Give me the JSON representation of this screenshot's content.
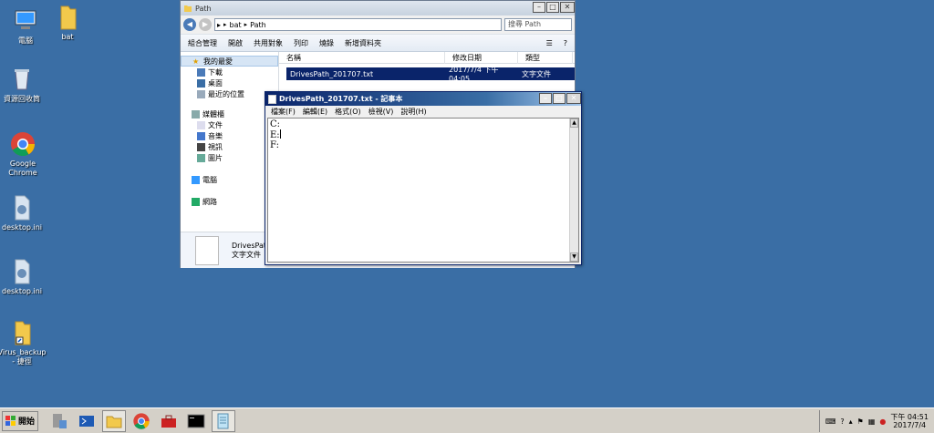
{
  "desktop": {
    "icons": [
      {
        "label": "電腦",
        "icon": "computer-icon"
      },
      {
        "label": "bat",
        "icon": "folder-icon"
      },
      {
        "label": "資源回收筒",
        "icon": "recycle-bin-icon"
      },
      {
        "label": "Google Chrome",
        "icon": "chrome-icon"
      },
      {
        "label": "desktop.ini",
        "icon": "settings-file-icon"
      },
      {
        "label": "desktop.ini",
        "icon": "settings-file-icon"
      },
      {
        "label": "Virus_backup - 捷徑",
        "icon": "folder-shortcut-icon"
      }
    ]
  },
  "explorer": {
    "title": "Path",
    "breadcrumb": [
      "bat",
      "Path"
    ],
    "search_placeholder": "搜尋 Path",
    "toolbar": [
      "組合管理",
      "開啟",
      "共用對象",
      "列印",
      "燒錄",
      "新增資料夾"
    ],
    "nav": {
      "favorites": "我的最愛",
      "favorites_items": [
        "下載",
        "桌面",
        "最近的位置"
      ],
      "libraries": "媒體櫃",
      "libraries_items": [
        "文件",
        "音樂",
        "視訊",
        "圖片"
      ],
      "computer": "電腦",
      "network": "網路"
    },
    "columns": [
      "名稱",
      "修改日期",
      "類型"
    ],
    "file": {
      "name": "DrivesPath_201707.txt",
      "modified": "2017/7/4 下午 04:05",
      "type": "文字文件"
    },
    "details": {
      "name": "DrivesPath",
      "type": "文字文件"
    }
  },
  "notepad": {
    "title": "DrivesPath_201707.txt - 記事本",
    "menu": [
      "檔案(F)",
      "編輯(E)",
      "格式(O)",
      "檢視(V)",
      "說明(H)"
    ],
    "lines": [
      "C:",
      "E:",
      "F:"
    ]
  },
  "taskbar": {
    "start_label": "開始",
    "clock_time": "下午 04:51",
    "clock_date": "2017/7/4"
  },
  "colors": {
    "desktop": "#3a6ea5",
    "selection": "#0a246a",
    "taskbar": "#d4d0c8"
  }
}
